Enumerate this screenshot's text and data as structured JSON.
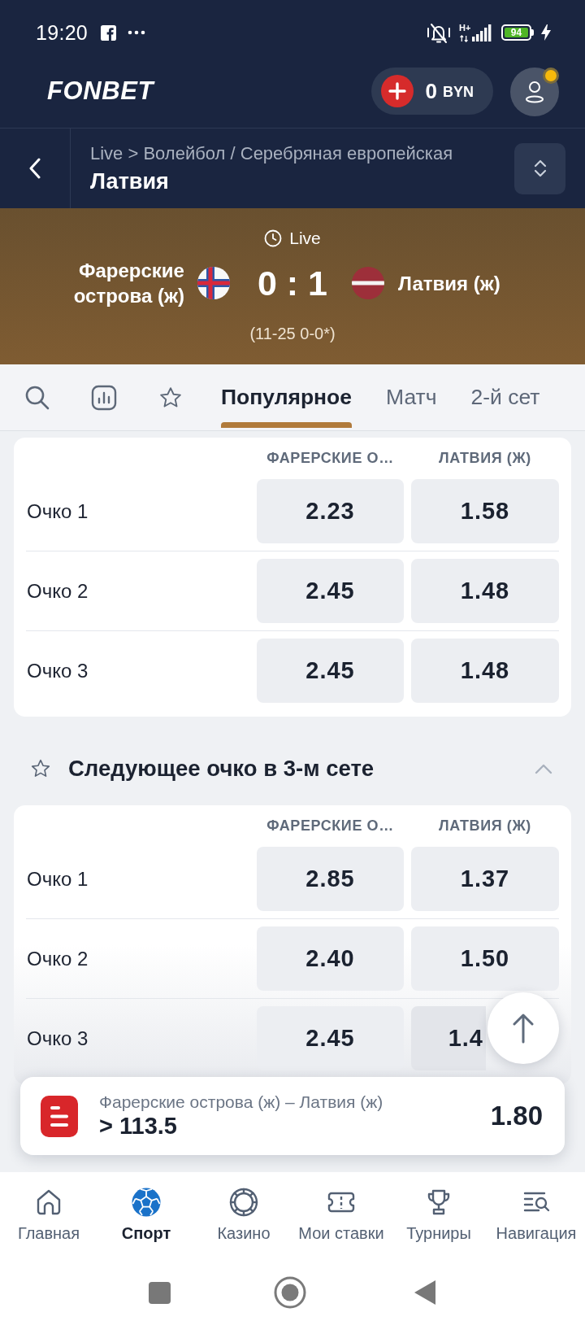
{
  "status_bar": {
    "time": "19:20",
    "network": "H+",
    "battery": "94"
  },
  "header": {
    "logo": "FONBET",
    "balance": {
      "amount": "0",
      "currency": "BYN"
    },
    "profile": {
      "notification": true
    }
  },
  "breadcrumb": {
    "path": "Live > Волейбол / Серебряная европейская",
    "title": "Латвия"
  },
  "match": {
    "status": "Live",
    "home": {
      "name": "Фарерские острова (ж)"
    },
    "score": "0 : 1",
    "away": {
      "name": "Латвия (ж)"
    },
    "sets": "(11-25 0-0*)"
  },
  "tabs": [
    {
      "kind": "search",
      "selected": false
    },
    {
      "kind": "stats",
      "selected": false
    },
    {
      "kind": "favorites",
      "selected": false
    },
    {
      "kind": "text",
      "label": "Популярное",
      "selected": true
    },
    {
      "kind": "text",
      "label": "Матч",
      "selected": false
    },
    {
      "kind": "text",
      "label": "2-й сет",
      "selected": false
    }
  ],
  "markets": [
    {
      "columns": [
        "ФАРЕРСКИЕ О…",
        "ЛАТВИЯ (Ж)"
      ],
      "rows": [
        {
          "label": "Очко 1",
          "odds": [
            "2.23",
            "1.58"
          ]
        },
        {
          "label": "Очко 2",
          "odds": [
            "2.45",
            "1.48"
          ]
        },
        {
          "label": "Очко 3",
          "odds": [
            "2.45",
            "1.48"
          ]
        }
      ]
    },
    {
      "title": "Следующее очко в 3-м сете",
      "favorite": false,
      "expanded": true,
      "columns": [
        "ФАРЕРСКИЕ О…",
        "ЛАТВИЯ (Ж)"
      ],
      "rows": [
        {
          "label": "Очко 1",
          "odds": [
            "2.85",
            "1.37"
          ]
        },
        {
          "label": "Очко 2",
          "odds": [
            "2.40",
            "1.50"
          ]
        },
        {
          "label": "Очко 3",
          "odds": [
            "2.45",
            "1.4"
          ]
        }
      ]
    }
  ],
  "bet_slip": {
    "event": "Фарерские острова (ж) – Латвия (ж)",
    "selection": "> 113.5",
    "odds": "1.80"
  },
  "bottom_nav": [
    {
      "kind": "home",
      "label": "Главная",
      "selected": false
    },
    {
      "kind": "sport",
      "label": "Спорт",
      "selected": true
    },
    {
      "kind": "casino",
      "label": "Казино",
      "selected": false
    },
    {
      "kind": "bets",
      "label": "Мои ставки",
      "selected": false
    },
    {
      "kind": "tournaments",
      "label": "Турниры",
      "selected": false
    },
    {
      "kind": "navigation",
      "label": "Навигация",
      "selected": false
    }
  ]
}
